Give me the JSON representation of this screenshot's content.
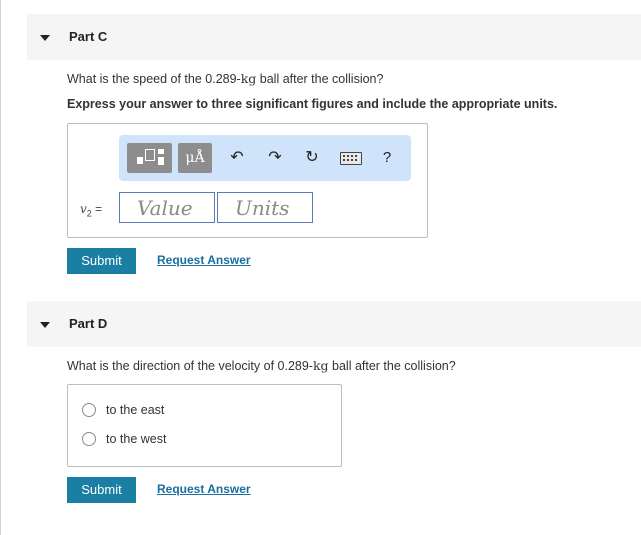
{
  "part_c": {
    "title": "Part C",
    "question_prefix": "What is the speed of the 0.289-",
    "question_unit": "kg",
    "question_suffix": " ball after the collision?",
    "instruction": "Express your answer to three significant figures and include the appropriate units.",
    "toolbar": {
      "units_symbol": "μÅ",
      "undo_glyph": "↶",
      "redo_glyph": "↷",
      "reset_glyph": "↻",
      "help_glyph": "?"
    },
    "variable": "v",
    "variable_sub": "2",
    "equals": " =",
    "value_placeholder": "Value",
    "units_placeholder": "Units",
    "submit_label": "Submit",
    "request_label": "Request Answer"
  },
  "part_d": {
    "title": "Part D",
    "question_prefix": "What is the direction of the velocity of 0.289-",
    "question_unit": "kg",
    "question_suffix": " ball after the collision?",
    "options": [
      "to the east",
      "to the west"
    ],
    "submit_label": "Submit",
    "request_label": "Request Answer"
  },
  "icons": {
    "collapse": "triangle-down-icon",
    "templates": "templates-icon",
    "units": "units-icon",
    "undo": "undo-icon",
    "redo": "redo-icon",
    "reset": "reset-icon",
    "keyboard": "keyboard-icon",
    "help": "help-icon"
  },
  "colors": {
    "accent": "#1b7ea3",
    "link": "#1b6ea0",
    "toolbar_bg": "#cfe4fb",
    "header_bg": "#f5f5f5"
  }
}
